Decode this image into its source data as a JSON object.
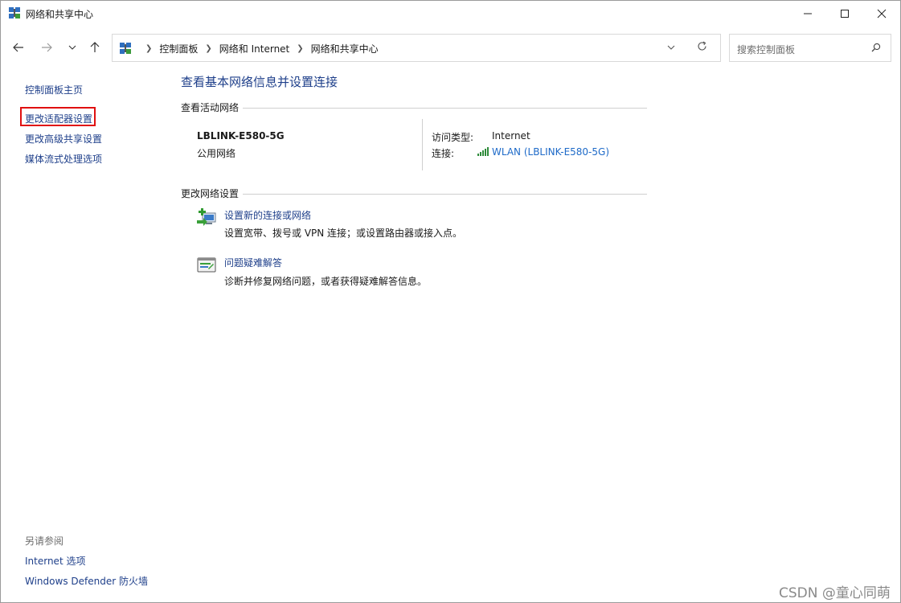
{
  "window": {
    "title": "网络和共享中心",
    "minimize_icon": "minimize-icon",
    "maximize_icon": "maximize-icon",
    "close_icon": "close-icon"
  },
  "nav": {
    "back_icon": "arrow-left-icon",
    "forward_icon": "arrow-right-icon",
    "recent_icon": "chevron-down-icon",
    "up_icon": "arrow-up-icon"
  },
  "address": {
    "breadcrumbs": [
      "控制面板",
      "网络和 Internet",
      "网络和共享中心"
    ],
    "dropdown_icon": "chevron-down-icon",
    "refresh_icon": "refresh-icon"
  },
  "search": {
    "placeholder": "搜索控制面板",
    "icon": "search-icon"
  },
  "sidebar": {
    "links": [
      "控制面板主页",
      "更改适配器设置",
      "更改高级共享设置",
      "媒体流式处理选项"
    ],
    "see_also_heading": "另请参阅",
    "see_also_links": [
      "Internet 选项",
      "Windows Defender 防火墙"
    ]
  },
  "main": {
    "title": "查看基本网络信息并设置连接",
    "active_networks_header": "查看活动网络",
    "network": {
      "name": "LBLINK-E580-5G",
      "category": "公用网络",
      "access_type_label": "访问类型:",
      "access_type_value": "Internet",
      "connection_label": "连接:",
      "connection_value": "WLAN (LBLINK-E580-5G)"
    },
    "change_settings_header": "更改网络设置",
    "tasks": [
      {
        "link": "设置新的连接或网络",
        "description": "设置宽带、拨号或 VPN 连接；或设置路由器或接入点。",
        "icon": "new-connection-icon"
      },
      {
        "link": "问题疑难解答",
        "description": "诊断并修复网络问题，或者获得疑难解答信息。",
        "icon": "troubleshoot-icon"
      }
    ]
  },
  "watermark": "CSDN @童心同萌"
}
